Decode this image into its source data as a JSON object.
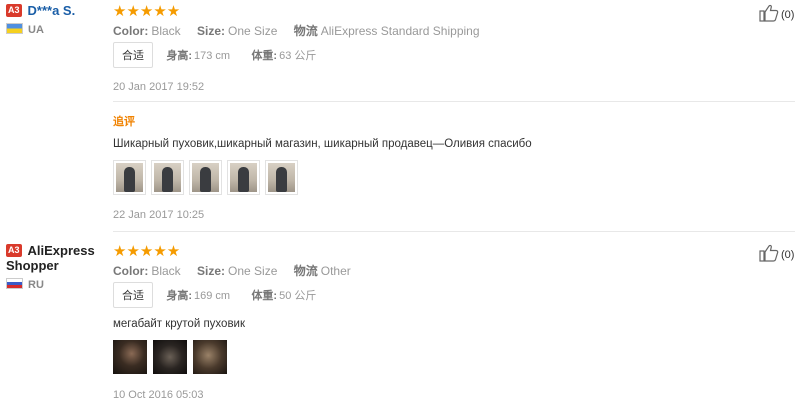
{
  "reviews": [
    {
      "level": "A3",
      "name": "D***a S.",
      "country": "UA",
      "stars": "★★★★★",
      "color_label": "Color:",
      "color": "Black",
      "size_label": "Size:",
      "size": "One Size",
      "logistics_label": "物流",
      "logistics": "AliExpress Standard Shipping",
      "fit": "合适",
      "height_label": "身高:",
      "height": "173 cm",
      "weight_label": "体重:",
      "weight": "63 公斤",
      "date": "20 Jan 2017 19:52",
      "additional_label": "追评",
      "additional_text": "Шикарный пуховик,шикарный магазин, шикарный продавец—Оливия спасибо",
      "additional_date": "22 Jan 2017 10:25",
      "helpful_count": "(0)"
    },
    {
      "level": "A3",
      "name": "AliExpress Shopper",
      "country": "RU",
      "stars": "★★★★★",
      "color_label": "Color:",
      "color": "Black",
      "size_label": "Size:",
      "size": "One Size",
      "logistics_label": "物流",
      "logistics": "Other",
      "fit": "合适",
      "height_label": "身高:",
      "height": "169 cm",
      "weight_label": "体重:",
      "weight": "50 公斤",
      "text": "мегабайт крутой пуховик",
      "date": "10 Oct 2016 05:03",
      "helpful_count": "(0)"
    }
  ],
  "icons": {
    "thumbs_up": "thumbs-up-icon",
    "level_badge_color": "#d93a2b",
    "star_color": "#f59b00",
    "additional_label_color": "#f08200"
  }
}
